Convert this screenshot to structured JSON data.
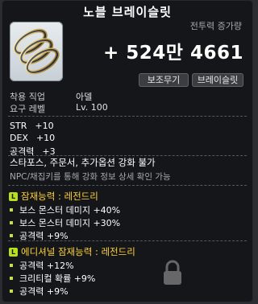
{
  "title": "노블 브레이슬릿",
  "combat_power": {
    "label": "전투력 증가량",
    "value": "+ 524만 4661"
  },
  "tags": [
    "보조무기",
    "브레이슬릿"
  ],
  "requirements": [
    {
      "label": "착용 직업",
      "value": "아델"
    },
    {
      "label": "요구 레벨",
      "value": "Lv. 100"
    }
  ],
  "stats": [
    {
      "name": "STR",
      "value": "+10"
    },
    {
      "name": "DEX",
      "value": "+10"
    },
    {
      "name": "공격력",
      "value": "+3"
    }
  ],
  "notes": {
    "restriction": "스타포스, 주문서, 추가옵션 강화 불가",
    "info": "NPC/채집키를 통해 강화 정보 상세 확인 가능"
  },
  "potential": {
    "badge": "L",
    "header": "잠재능력 : 레전드리",
    "lines": [
      "보스 몬스터 데미지 +40%",
      "보스 몬스터 데미지 +30%",
      "공격력 +9%"
    ]
  },
  "additional_potential": {
    "badge": "L",
    "header": "에디셔널 잠재능력 : 레전드리",
    "lines": [
      "공격력 +12%",
      "크리티컬 확률 +9%",
      "공격력 +9%"
    ]
  },
  "colors": {
    "potential_header": "#ffd23c",
    "badge": "#b7e021",
    "bullet": "#c2e24a"
  }
}
